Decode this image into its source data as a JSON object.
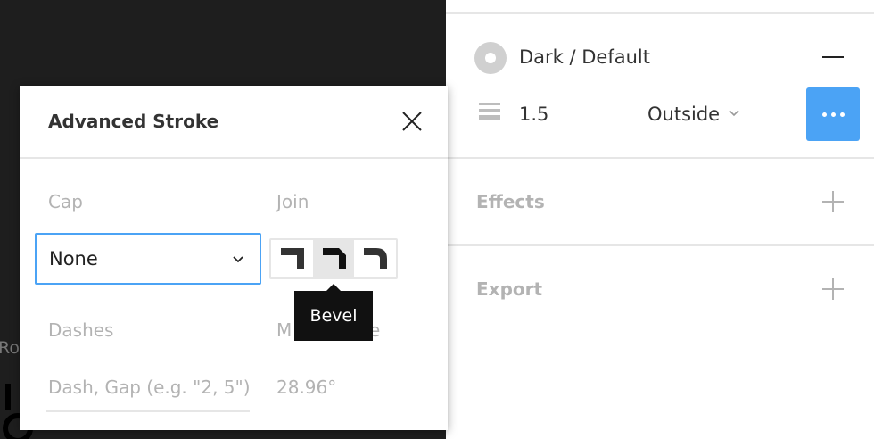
{
  "canvas": {
    "peek_text": "Ro"
  },
  "stroke": {
    "color_name": "Dark / Default",
    "weight": "1.5",
    "position": "Outside",
    "icons": {
      "swatch": "color-swatch-icon",
      "weight": "stroke-weight-icon",
      "remove": "minus-icon",
      "more": "more-icon"
    }
  },
  "sections": {
    "effects": "Effects",
    "export": "Export"
  },
  "modal": {
    "title": "Advanced Stroke",
    "cap_label": "Cap",
    "cap_value": "None",
    "join_label": "Join",
    "join_options": [
      "Miter",
      "Bevel",
      "Round"
    ],
    "join_selected": "Bevel",
    "tooltip": "Bevel",
    "dashes_label": "Dashes",
    "dashes_placeholder": "Dash, Gap (e.g. \"2, 5\")",
    "miter_label": "Miter Angle",
    "miter_label_visible_start": "M",
    "miter_label_visible_end": "e",
    "miter_value": "28.96°"
  },
  "colors": {
    "accent": "#4ba3f5",
    "canvas": "#1e1e1e",
    "muted": "#b3b3b3"
  }
}
